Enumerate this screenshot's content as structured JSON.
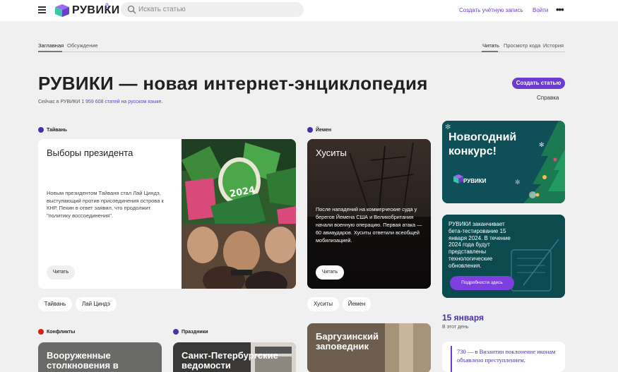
{
  "header": {
    "logo_text": "РУВИКИ",
    "logo_beta": "β",
    "search_placeholder": "Искать статью",
    "create_account": "Создать учётную запись",
    "login": "Войти",
    "more": "•••"
  },
  "tabs": {
    "left": [
      "Заглавная",
      "Обсуждение"
    ],
    "right": [
      "Читать",
      "Просмотр кода",
      "История"
    ]
  },
  "page": {
    "title": "РУВИКИ — новая интернет-энциклопедия",
    "subtitle_prefix": "Сейчас в РУВИКИ ",
    "subtitle_count": "1 959 608 статей",
    "subtitle_mid": " на ",
    "subtitle_lang": "русском языке",
    "subtitle_suffix": ".",
    "create_article": "Создать статью",
    "help": "Справка"
  },
  "sections": {
    "taiwan": {
      "label": "Тайвань",
      "dot_color": "#4a2fa8",
      "card_title": "Выборы президента",
      "card_text": "Новым президентом Тайваня стал Лай Циндэ, выступающий против присоединения острова к КНР. Пекин в ответ заявил, что продолжит \"политику воссоединения\".",
      "read": "Читать",
      "tags": [
        "Тайвань",
        "Лай Циндэ"
      ]
    },
    "yemen": {
      "label": "Йемен",
      "dot_color": "#4a2fa8",
      "card_title": "Хуситы",
      "card_text": "После нападений на коммерческие суда у берегов Йемена США и Великобритания начали военную операцию. Первая атака — 60 авиаударов. Хуситы ответили всеобщей мобилизацией.",
      "read": "Читать",
      "tags": [
        "Хуситы",
        "Йемен"
      ]
    },
    "conflicts": {
      "label": "Конфликты",
      "dot_color": "#d91c1c",
      "card_title": "Вооруженные столкновения в"
    },
    "holidays": {
      "label": "Праздники",
      "dot_color": "#4a2fa8",
      "card_title": "Санкт-Петербургские ведомости"
    },
    "reserve": {
      "card_title": "Баргузинский заповедник"
    }
  },
  "right": {
    "promo1_title": "Новогодний конкурс!",
    "promo1_logo": "РУВИКИ",
    "promo2_text": "РУВИКИ заканчивает бета-тестирование 15 января 2024. В течение 2024 года будут представлены технологические обновления.",
    "promo2_button": "Подробности здесь",
    "date": "15 января",
    "date_sub": "В этот день",
    "event_year": "730",
    "event_dash": " — в ",
    "event_place": "Византии",
    "event_text": " поклонение иконам объявлено преступлением."
  },
  "colors": {
    "accent": "#6a3ccf",
    "conflict": "#d91c1c",
    "teal": "#0f4f57"
  }
}
